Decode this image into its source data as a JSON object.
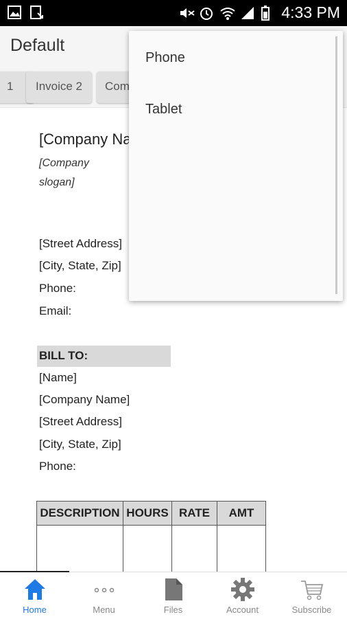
{
  "status_bar": {
    "time": "4:33 PM"
  },
  "app_bar": {
    "title": "Default"
  },
  "tabs": [
    {
      "label": "1"
    },
    {
      "label": "Invoice 2"
    },
    {
      "label": "Com"
    }
  ],
  "document": {
    "company_name": "[Company Name]",
    "slogan_line1": "[Company",
    "slogan_line2": "slogan]",
    "street": "[Street Address]",
    "city": "[City, State,  Zip]",
    "phone_label": "Phone:",
    "email_label": "Email:",
    "bill_to_label": "BILL TO:",
    "bill_name": "[Name]",
    "bill_company": "[Company Name]",
    "bill_street": "[Street Address]",
    "bill_city": "[City, State,  Zip]",
    "bill_phone": "Phone:",
    "table_headers": [
      "DESCRIPTION",
      "HOURS",
      "RATE",
      "AMT"
    ]
  },
  "dropdown": {
    "items": [
      {
        "label": "Phone"
      },
      {
        "label": "Tablet"
      }
    ]
  },
  "bottom_nav": {
    "items": [
      {
        "label": "Home"
      },
      {
        "label": "Menu"
      },
      {
        "label": "Files"
      },
      {
        "label": "Account"
      },
      {
        "label": "Subscribe"
      }
    ],
    "active_color": "#1e7be6"
  }
}
